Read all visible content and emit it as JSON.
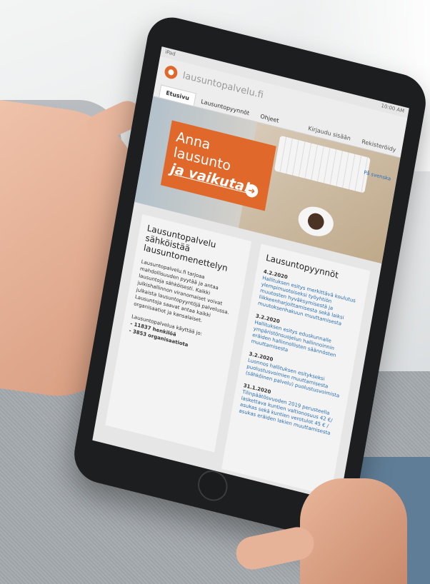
{
  "statusbar": {
    "device": "iPad",
    "time": "10:00 AM"
  },
  "logo": {
    "text": "lausuntopalvelu.fi"
  },
  "nav": {
    "tabs": [
      {
        "label": "Etusivu"
      },
      {
        "label": "Lausuntopyynnöt"
      },
      {
        "label": "Ohjeet"
      }
    ],
    "right": [
      {
        "label": "Kirjaudu sisään"
      },
      {
        "label": "Rekisteröidy"
      }
    ]
  },
  "hero": {
    "line1": "Anna lausunto",
    "line2": "ja vaikuta!",
    "arrow": "➜",
    "language": "På svenska"
  },
  "intro": {
    "title": "Lausuntopalvelu sähköistää lausuntomenettelyn",
    "body": "Lausuntopalvelu.fi tarjoaa mahdollisuuden pyytää ja antaa lausuntoja sähköisesti. Kaikki julkishallinnon viranomaiset voivat julkaista lausuntopyyntöjä palvelussa. Lausuntoja saavat antaa kaikki organisaatiot ja kansalaiset.",
    "stats_label": "Lausuntopalvelua käyttää jo:",
    "stats": [
      "- 11837 henkilöä",
      "- 3853 organisaatiota"
    ]
  },
  "requests": {
    "title": "Lausuntopyynnöt",
    "items": [
      {
        "date": "4.2.2020",
        "text": "Hallituksen esitys merkittävä koulutus ylempimuotoiseksi työyhtiön muutosten hyväksymisestä ja liikkeenharjoittamisesta sekä laiksi muutoksenhakuun muuttamisesta"
      },
      {
        "date": "3.2.2020",
        "text": "Hallituksen esitys eduskunnalle ympäristönsuojelun hallinnoinnin eräiden hallinnollisten säännösten muuttamisesta"
      },
      {
        "date": "3.2.2020",
        "text": "Luonnos hallituksen esitykseksi puolustusvoimien muuttamisesta (sähköinen palvelu) puolustusvoimista"
      },
      {
        "date": "31.1.2020",
        "text": "Tilinpäätösvuoden 2019 perusteella laskettava kuntien valtionosuus 42 €/ asukas sekä kuntien verotulot 45 € / asukas eräiden lakien muuttamisesta"
      }
    ]
  },
  "colors": {
    "accent": "#e0682b",
    "link": "#2c6fb3"
  }
}
